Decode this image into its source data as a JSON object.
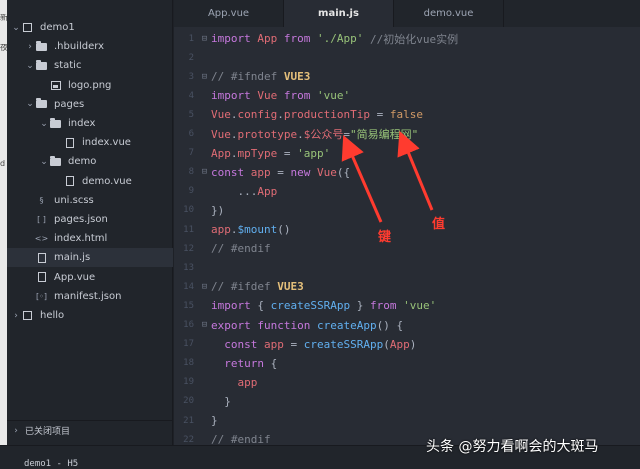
{
  "edge_fragments": [
    "新",
    "夜",
    "d"
  ],
  "sidebar": {
    "items": [
      {
        "label": "demo1",
        "depth": 0,
        "chevron": "open",
        "icon": "box-icon"
      },
      {
        "label": ".hbuilderx",
        "depth": 1,
        "chevron": "closed",
        "icon": "folder-icon"
      },
      {
        "label": "static",
        "depth": 1,
        "chevron": "open",
        "icon": "folder-icon"
      },
      {
        "label": "logo.png",
        "depth": 2,
        "chevron": "none",
        "icon": "image-icon"
      },
      {
        "label": "pages",
        "depth": 1,
        "chevron": "open",
        "icon": "folder-icon"
      },
      {
        "label": "index",
        "depth": 2,
        "chevron": "open",
        "icon": "folder-icon"
      },
      {
        "label": "index.vue",
        "depth": 3,
        "chevron": "none",
        "icon": "vue-file-icon"
      },
      {
        "label": "demo",
        "depth": 2,
        "chevron": "open",
        "icon": "folder-icon"
      },
      {
        "label": "demo.vue",
        "depth": 3,
        "chevron": "none",
        "icon": "vue-file-icon"
      },
      {
        "label": "uni.scss",
        "depth": 1,
        "chevron": "none",
        "icon": "scss-file-icon"
      },
      {
        "label": "pages.json",
        "depth": 1,
        "chevron": "none",
        "icon": "json-file-icon"
      },
      {
        "label": "index.html",
        "depth": 1,
        "chevron": "none",
        "icon": "html-file-icon"
      },
      {
        "label": "main.js",
        "depth": 1,
        "chevron": "none",
        "icon": "js-file-icon",
        "selected": true
      },
      {
        "label": "App.vue",
        "depth": 1,
        "chevron": "none",
        "icon": "vue-file-icon"
      },
      {
        "label": "manifest.json",
        "depth": 1,
        "chevron": "none",
        "icon": "manifest-file-icon"
      },
      {
        "label": "hello",
        "depth": 0,
        "chevron": "closed",
        "icon": "box-icon"
      }
    ],
    "closed_projects": "已关闭项目"
  },
  "tabs": [
    {
      "label": "App.vue",
      "active": false
    },
    {
      "label": "main.js",
      "active": true
    },
    {
      "label": "demo.vue",
      "active": false
    }
  ],
  "code_lines": [
    [
      [
        "kw",
        "import "
      ],
      [
        "var",
        "App "
      ],
      [
        "kw",
        "from "
      ],
      [
        "str",
        "'./App' "
      ],
      [
        "cmt",
        "//初始化vue实例"
      ]
    ],
    [],
    [
      [
        "cmt",
        "// #ifndef "
      ],
      [
        "dir",
        "VUE3"
      ]
    ],
    [
      [
        "kw",
        "import "
      ],
      [
        "var",
        "Vue "
      ],
      [
        "kw",
        "from "
      ],
      [
        "str",
        "'vue'"
      ]
    ],
    [
      [
        "var",
        "Vue"
      ],
      [
        "code",
        "."
      ],
      [
        "var",
        "config"
      ],
      [
        "code",
        "."
      ],
      [
        "var",
        "productionTip "
      ],
      [
        "code",
        "= "
      ],
      [
        "bool",
        "false"
      ]
    ],
    [
      [
        "var",
        "Vue"
      ],
      [
        "code",
        "."
      ],
      [
        "var",
        "prototype"
      ],
      [
        "code",
        "."
      ],
      [
        "var",
        "$公众号"
      ],
      [
        "code",
        "="
      ],
      [
        "str",
        "\"简易编程网\""
      ]
    ],
    [
      [
        "var",
        "App"
      ],
      [
        "code",
        "."
      ],
      [
        "var",
        "mpType "
      ],
      [
        "code",
        "= "
      ],
      [
        "str",
        "'app'"
      ]
    ],
    [
      [
        "kw",
        "const "
      ],
      [
        "var",
        "app "
      ],
      [
        "code",
        "= "
      ],
      [
        "kw",
        "new "
      ],
      [
        "var",
        "Vue"
      ],
      [
        "code",
        "({"
      ]
    ],
    [
      [
        "code",
        "    ..."
      ],
      [
        "var",
        "App"
      ]
    ],
    [
      [
        "code",
        "})"
      ]
    ],
    [
      [
        "var",
        "app"
      ],
      [
        "code",
        "."
      ],
      [
        "fn",
        "$mount"
      ],
      [
        "code",
        "()"
      ]
    ],
    [
      [
        "cmt",
        "// #endif"
      ]
    ],
    [],
    [
      [
        "cmt",
        "// #ifdef "
      ],
      [
        "dir",
        "VUE3"
      ]
    ],
    [
      [
        "kw",
        "import "
      ],
      [
        "code",
        "{ "
      ],
      [
        "fn",
        "createSSRApp "
      ],
      [
        "code",
        "} "
      ],
      [
        "kw",
        "from "
      ],
      [
        "str",
        "'vue'"
      ]
    ],
    [
      [
        "kw",
        "export "
      ],
      [
        "kw",
        "function "
      ],
      [
        "fn",
        "createApp"
      ],
      [
        "code",
        "() {"
      ]
    ],
    [
      [
        "code",
        "  "
      ],
      [
        "kw",
        "const "
      ],
      [
        "var",
        "app "
      ],
      [
        "code",
        "= "
      ],
      [
        "fn",
        "createSSRApp"
      ],
      [
        "code",
        "("
      ],
      [
        "var",
        "App"
      ],
      [
        "code",
        ")"
      ]
    ],
    [
      [
        "code",
        "  "
      ],
      [
        "kw",
        "return "
      ],
      [
        "code",
        "{"
      ]
    ],
    [
      [
        "code",
        "    "
      ],
      [
        "var",
        "app"
      ]
    ],
    [
      [
        "code",
        "  }"
      ]
    ],
    [
      [
        "code",
        "}"
      ]
    ],
    [
      [
        "cmt",
        "// #endif"
      ]
    ]
  ],
  "fold_markers": [
    1,
    3,
    8,
    14,
    16
  ],
  "annotations": {
    "key_label": "键",
    "value_label": "值",
    "color": "#ff3b2f"
  },
  "status": {
    "text": "demo1 - H5"
  },
  "watermark": "头条 @努力看啊会的大斑马"
}
